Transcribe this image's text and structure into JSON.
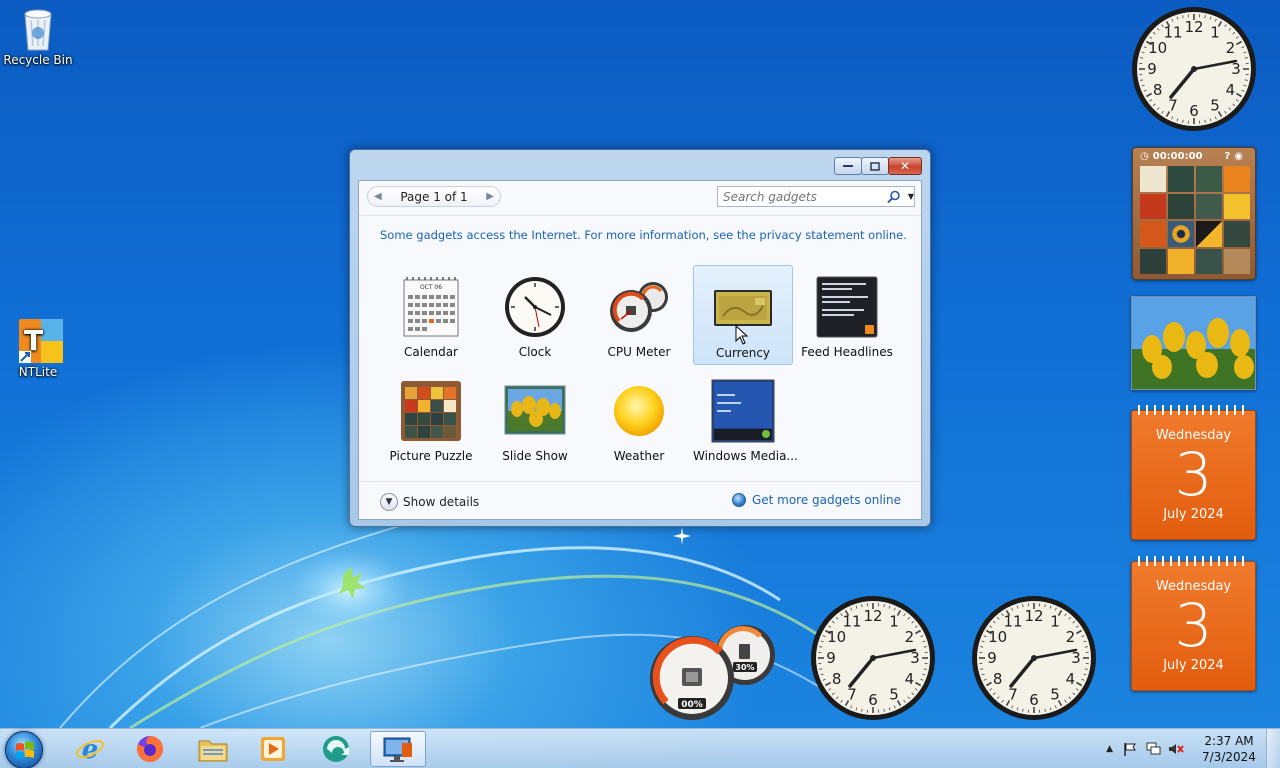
{
  "desktop": {
    "icons": [
      {
        "label": "Recycle Bin"
      },
      {
        "label": "NTLite"
      }
    ]
  },
  "gadget_window": {
    "pager_text": "Page 1 of 1",
    "search_placeholder": "Search gadgets",
    "info_text": "Some gadgets access the Internet.  For more information, see the privacy statement online.",
    "gadgets": [
      {
        "label": "Calendar",
        "icon": "calendar-icon"
      },
      {
        "label": "Clock",
        "icon": "clock-icon"
      },
      {
        "label": "CPU Meter",
        "icon": "gauge-icon"
      },
      {
        "label": "Currency",
        "icon": "currency-icon",
        "selected": true
      },
      {
        "label": "Feed Headlines",
        "icon": "feed-icon"
      },
      {
        "label": "Picture Puzzle",
        "icon": "puzzle-icon"
      },
      {
        "label": "Slide Show",
        "icon": "slideshow-icon"
      },
      {
        "label": "Weather",
        "icon": "sun-icon"
      },
      {
        "label": "Windows Media...",
        "icon": "media-center-icon"
      }
    ],
    "calendar_icon_month": "OCT 06",
    "show_details": "Show details",
    "get_more": "Get more gadgets online"
  },
  "side_gadgets": {
    "puzzle_timer": "00:00:00",
    "calendar1": {
      "weekday": "Wednesday",
      "day": "3",
      "month_year": "July 2024"
    },
    "calendar2": {
      "weekday": "Wednesday",
      "day": "3",
      "month_year": "July 2024"
    },
    "clock_numerals": [
      "12",
      "1",
      "2",
      "3",
      "4",
      "5",
      "6",
      "7",
      "8",
      "9",
      "10",
      "11"
    ],
    "cpu_meter": {
      "cpu": "00%",
      "memory": "30%"
    }
  },
  "taskbar": {
    "apps": [
      "internet-explorer-icon",
      "firefox-icon",
      "file-explorer-icon",
      "media-player-icon",
      "app-icon",
      "gadgets-app-icon"
    ],
    "time": "2:37 AM",
    "date": "7/3/2024"
  },
  "colors": {
    "accent": "#1a63b3",
    "calendar": "#e8671a",
    "selection": "#cde4f9"
  }
}
